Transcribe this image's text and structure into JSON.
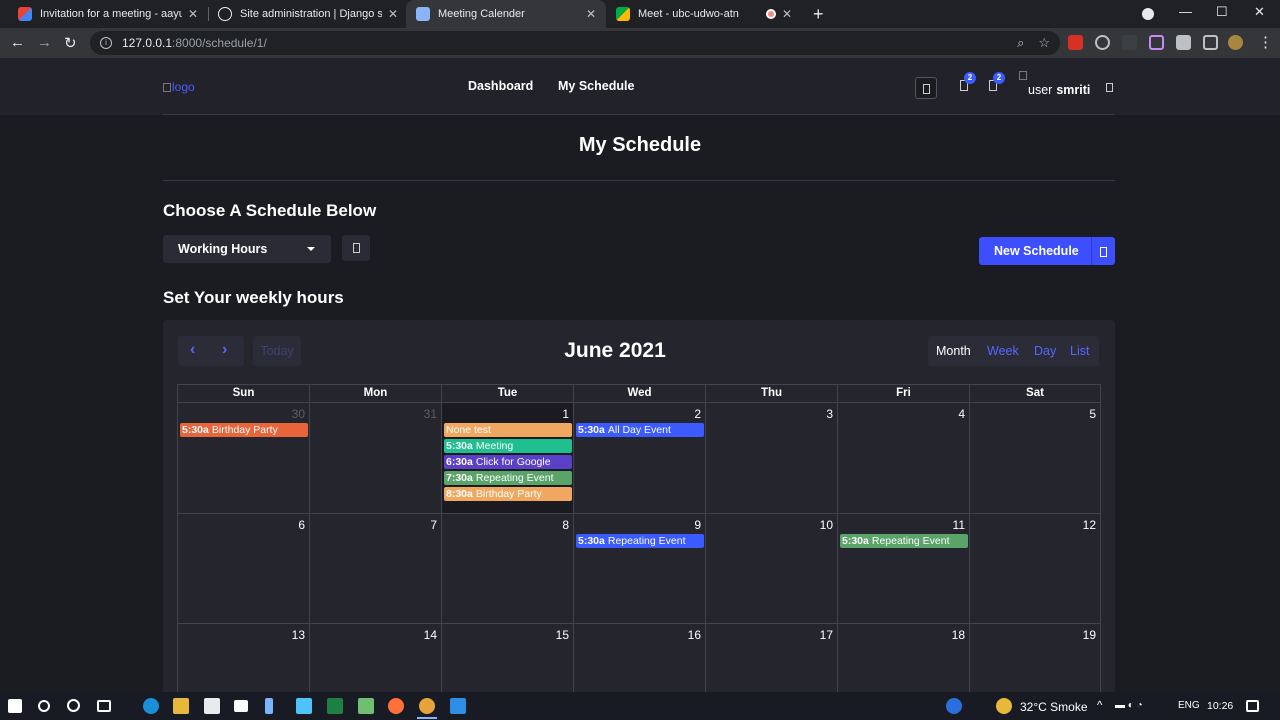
{
  "browser": {
    "tabs": [
      {
        "title": "Invitation for a meeting - aayush",
        "icon": "gmail-icon",
        "color": "#ea4335"
      },
      {
        "title": "Site administration | Django site",
        "icon": "globe-icon",
        "color": "#e8eaed"
      },
      {
        "title": "Meeting Calender",
        "icon": "calendar-favicon",
        "color": "#8ab4f8"
      },
      {
        "title": "Meet - ubc-udwo-atn",
        "icon": "meet-icon",
        "color": "#00ac47"
      }
    ],
    "address_host": "127.0.0.1",
    "address_path": ":8000/schedule/1/"
  },
  "header": {
    "logo_alt": "logo",
    "nav": [
      "Dashboard",
      "My Schedule"
    ],
    "badges": [
      "2",
      "2"
    ],
    "user_alt": "user",
    "username": "smriti"
  },
  "page": {
    "title": "My Schedule",
    "choose_heading": "Choose A Schedule Below",
    "selected_schedule": "Working Hours",
    "new_schedule_label": "New Schedule",
    "weekly_heading": "Set Your weekly hours"
  },
  "calendar": {
    "title": "June 2021",
    "prev": "‹",
    "next": "›",
    "today_label": "Today",
    "views": [
      "Month",
      "Week",
      "Day",
      "List"
    ],
    "active_view": "Month",
    "weekdays": [
      "Sun",
      "Mon",
      "Tue",
      "Wed",
      "Thu",
      "Fri",
      "Sat"
    ],
    "weeks": [
      [
        {
          "n": "30",
          "other": true
        },
        {
          "n": "31",
          "other": true
        },
        {
          "n": "1",
          "today": true
        },
        {
          "n": "2"
        },
        {
          "n": "3"
        },
        {
          "n": "4"
        },
        {
          "n": "5"
        }
      ],
      [
        {
          "n": "6"
        },
        {
          "n": "7"
        },
        {
          "n": "8"
        },
        {
          "n": "9"
        },
        {
          "n": "10"
        },
        {
          "n": "11"
        },
        {
          "n": "12"
        }
      ],
      [
        {
          "n": "13"
        },
        {
          "n": "14"
        },
        {
          "n": "15"
        },
        {
          "n": "16"
        },
        {
          "n": "17"
        },
        {
          "n": "18"
        },
        {
          "n": "19"
        }
      ]
    ],
    "events": [
      {
        "week": 0,
        "day": 0,
        "slot": 0,
        "time": "5:30a",
        "title": "Birthday Party",
        "color": "#e8643a"
      },
      {
        "week": 0,
        "day": 2,
        "slot": 0,
        "time": "",
        "title": "None test",
        "color": "#f0a860"
      },
      {
        "week": 0,
        "day": 2,
        "slot": 1,
        "time": "5:30a",
        "title": "Meeting",
        "color": "#1fbf8f"
      },
      {
        "week": 0,
        "day": 2,
        "slot": 2,
        "time": "6:30a",
        "title": "Click for Google",
        "color": "#5a3fc7"
      },
      {
        "week": 0,
        "day": 2,
        "slot": 3,
        "time": "7:30a",
        "title": "Repeating Event",
        "color": "#5aa469"
      },
      {
        "week": 0,
        "day": 2,
        "slot": 4,
        "time": "8:30a",
        "title": "Birthday Party",
        "color": "#f0a860"
      },
      {
        "week": 0,
        "day": 3,
        "slot": 0,
        "time": "5:30a",
        "title": "All Day Event",
        "color": "#3b5bff"
      },
      {
        "week": 1,
        "day": 3,
        "slot": 0,
        "time": "5:30a",
        "title": "Repeating Event",
        "color": "#3b5bff"
      },
      {
        "week": 1,
        "day": 5,
        "slot": 0,
        "time": "5:30a",
        "title": "Repeating Event",
        "color": "#5aa469"
      }
    ]
  },
  "taskbar": {
    "weather": "32°C  Smoke",
    "lang": "ENG",
    "time": "10:26"
  }
}
